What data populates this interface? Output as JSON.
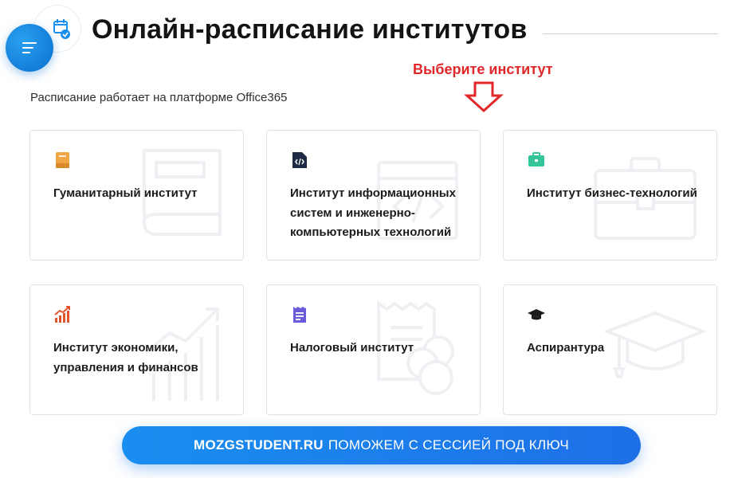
{
  "header": {
    "title": "Онлайн-расписание институтов",
    "icon": "calendar-check-icon",
    "menu_icon": "menu-icon"
  },
  "hint": {
    "text": "Выберите институт",
    "color": "#e0272a",
    "arrow_icon": "arrow-down-icon"
  },
  "subtitle": "Расписание работает на платформе Office365",
  "institutes": [
    {
      "label": "Гуманитарный институт",
      "icon": "book-icon",
      "color": "#f0a644"
    },
    {
      "label": "Институт информационных систем и инженерно-компьютерных технологий",
      "icon": "code-file-icon",
      "color": "#1c2a45"
    },
    {
      "label": "Институт бизнес-технологий",
      "icon": "briefcase-icon",
      "color": "#36c49a"
    },
    {
      "label": "Институт экономики, управления и финансов",
      "icon": "growth-chart-icon",
      "color": "#e3532c"
    },
    {
      "label": "Налоговый институт",
      "icon": "receipt-icon",
      "color": "#6a5cd8"
    },
    {
      "label": "Аспирантура",
      "icon": "graduation-cap-icon",
      "color": "#1c1c1c"
    }
  ],
  "promo": {
    "brand": "MOZGSTUDENT.RU",
    "text": "ПОМОЖЕМ С СЕССИЕЙ ПОД КЛЮЧ"
  }
}
